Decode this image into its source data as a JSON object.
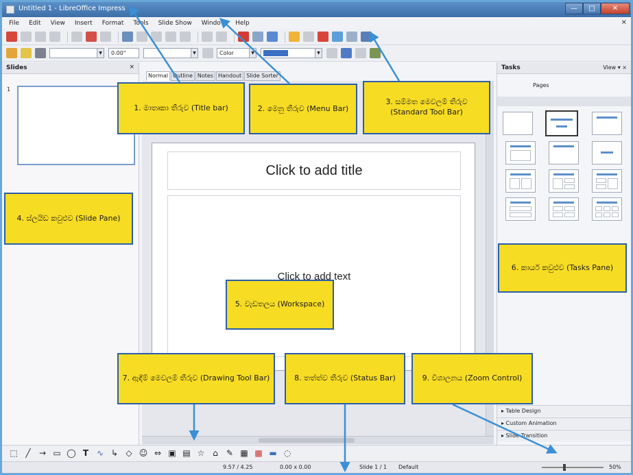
{
  "window": {
    "title": "Untitled 1 - LibreOffice Impress",
    "buttons": {
      "minimize": "—",
      "maximize": "□",
      "close": "✕"
    }
  },
  "menu": {
    "items": [
      "File",
      "Edit",
      "View",
      "Insert",
      "Format",
      "Tools",
      "Slide Show",
      "Window",
      "Help"
    ],
    "doc_close": "×"
  },
  "line_toolbar": {
    "line_width": "0.00\"",
    "area_style": "Color"
  },
  "slides_pane": {
    "title": "Slides",
    "close": "×",
    "slide_number": "1"
  },
  "view_tabs": [
    "Normal",
    "Outline",
    "Notes",
    "Handout",
    "Slide Sorter"
  ],
  "slide": {
    "title_placeholder": "Click to add title",
    "text_placeholder": "Click to add text"
  },
  "tasks_pane": {
    "title": "Tasks",
    "view_menu": "View ▾ ×",
    "master_pages": "Pages",
    "sections": [
      "▸ Table Design",
      "▸ Custom Animation",
      "▸ Slide Transition"
    ]
  },
  "status_bar": {
    "position": "9.57 / 4.25",
    "size": "0.00 x 0.00",
    "slide_info": "Slide 1 / 1",
    "master": "Default",
    "zoom": "50%"
  },
  "callouts": [
    {
      "text": "1. මාතෘකා තීරුව (Title bar)"
    },
    {
      "text": "2. මෙනු තීරුව (Menu Bar)"
    },
    {
      "text": "3. සම්මත මෙවලම් තීරුව (Standard Tool Bar)"
    },
    {
      "text": "4. ස්ලයිඩ කවුළුව (Slide Pane)"
    },
    {
      "text": "5. වැඩතලය (Workspace)"
    },
    {
      "text": "6. කාර්ය කවුළුව (Tasks Pane)"
    },
    {
      "text": "7. ඇඳීම් මෙවලම් තීරුව (Drawing Tool Bar)"
    },
    {
      "text": "8. තත්ත්ව තීරුව (Status Bar)"
    },
    {
      "text": "9. විශාලනය (Zoom Control)"
    }
  ],
  "colors": {
    "callout_fill": "#f7dc24",
    "callout_border": "#2a5fa8",
    "arrow": "#3a8fd6",
    "titlebar": "#3d6ea8"
  }
}
